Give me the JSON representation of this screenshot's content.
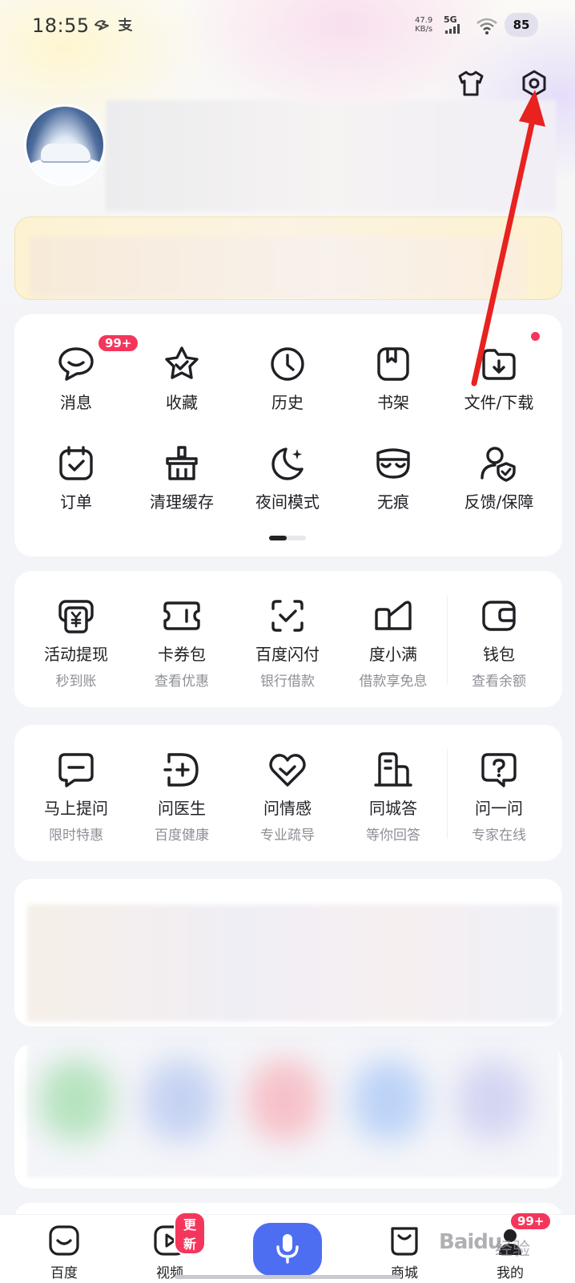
{
  "status_bar": {
    "time": "18:55",
    "net_speed_value": "47.9",
    "net_speed_unit": "KB/s",
    "network": "5G",
    "battery": "85"
  },
  "header": {
    "icons": [
      "shirt-icon",
      "settings-gear-icon"
    ]
  },
  "quick_grid": {
    "row1": [
      {
        "label": "消息",
        "icon": "message-icon",
        "badge": "99+"
      },
      {
        "label": "收藏",
        "icon": "star-icon"
      },
      {
        "label": "历史",
        "icon": "clock-icon"
      },
      {
        "label": "书架",
        "icon": "bookshelf-icon"
      },
      {
        "label": "文件/下载",
        "icon": "folder-download-icon",
        "dot": true
      }
    ],
    "row2": [
      {
        "label": "订单",
        "icon": "order-calendar-icon"
      },
      {
        "label": "清理缓存",
        "icon": "clean-cache-icon"
      },
      {
        "label": "夜间模式",
        "icon": "moon-icon"
      },
      {
        "label": "无痕",
        "icon": "mask-icon"
      },
      {
        "label": "反馈/保障",
        "icon": "feedback-shield-icon"
      }
    ],
    "pager_active": 1,
    "pager_total": 2
  },
  "finance": [
    {
      "label": "活动提现",
      "sub": "秒到账",
      "icon": "cash-withdraw-icon"
    },
    {
      "label": "卡券包",
      "sub": "查看优惠",
      "icon": "coupon-icon"
    },
    {
      "label": "百度闪付",
      "sub": "银行借款",
      "icon": "flash-pay-icon"
    },
    {
      "label": "度小满",
      "sub": "借款享免息",
      "icon": "duxiaoman-icon"
    },
    {
      "label": "钱包",
      "sub": "查看余额",
      "icon": "wallet-icon"
    }
  ],
  "services": [
    {
      "label": "马上提问",
      "sub": "限时特惠",
      "icon": "ask-icon"
    },
    {
      "label": "问医生",
      "sub": "百度健康",
      "icon": "doctor-icon"
    },
    {
      "label": "问情感",
      "sub": "专业疏导",
      "icon": "heart-icon"
    },
    {
      "label": "同城答",
      "sub": "等你回答",
      "icon": "building-icon"
    },
    {
      "label": "问一问",
      "sub": "专家在线",
      "icon": "question-icon"
    }
  ],
  "tabbar": {
    "tabs": [
      {
        "label": "百度",
        "icon": "baidu-home-icon"
      },
      {
        "label": "视频",
        "icon": "video-icon",
        "badge": "更新"
      },
      {
        "label": "",
        "icon": "microphone-icon"
      },
      {
        "label": "商城",
        "icon": "shop-bag-icon"
      },
      {
        "label": "我的",
        "icon": "profile-icon",
        "badge": "99+"
      }
    ]
  },
  "watermark": {
    "text": "Baidu",
    "sub": "经验"
  },
  "colors": {
    "accent_red": "#f5365c",
    "mic_blue": "#4e6ef2",
    "annotation_arrow": "#e8221f"
  }
}
